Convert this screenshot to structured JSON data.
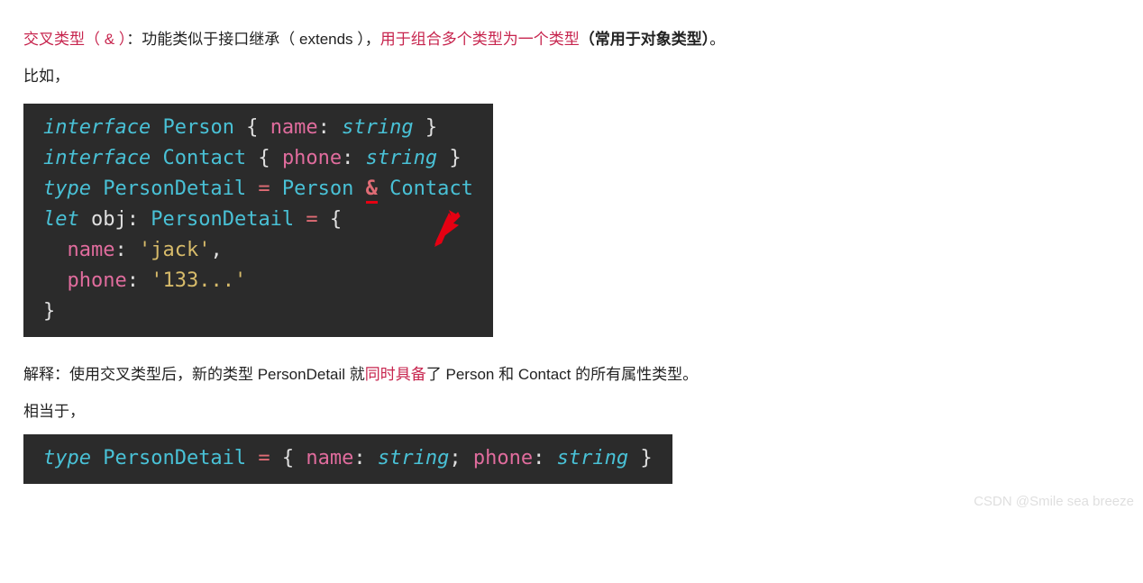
{
  "desc": {
    "intersection_label": "交叉类型",
    "paren_amp": "（ & ）",
    "func_text": "：功能类似于接口继承（ extends ），",
    "combine_text": "用于组合多个类型为一个类型",
    "object_type_text": "（常用于对象类型）",
    "period": "。"
  },
  "example_label": "比如，",
  "code1": {
    "l1_kw": "interface",
    "l1_type": " Person",
    "l1_brace_open": " { ",
    "l1_prop": "name",
    "l1_colon": ": ",
    "l1_strtype": "string",
    "l1_brace_close": " }",
    "l2_kw": "interface",
    "l2_type": " Contact",
    "l2_brace_open": " { ",
    "l2_prop": "phone",
    "l2_colon": ": ",
    "l2_strtype": "string",
    "l2_brace_close": " }",
    "l3_kw": "type",
    "l3_name": " PersonDetail ",
    "l3_eq": "=",
    "l3_person": " Person ",
    "l3_amp": "&",
    "l3_contact": " Contact",
    "l4_kw": "let",
    "l4_obj": " obj",
    "l4_colon": ": ",
    "l4_type": "PersonDetail ",
    "l4_eq": "=",
    "l4_brace": " {",
    "l5_indent": "  ",
    "l5_prop": "name",
    "l5_colon": ": ",
    "l5_val": "'jack'",
    "l5_comma": ",",
    "l6_indent": "  ",
    "l6_prop": "phone",
    "l6_colon": ": ",
    "l6_val": "'133...'",
    "l7_brace": "}"
  },
  "explain": {
    "prefix": "解释：使用交叉类型后，新的类型 PersonDetail 就",
    "highlight": "同时具备",
    "suffix": "了 Person 和 Contact 的所有属性类型。"
  },
  "equiv_label": "相当于，",
  "code2": {
    "kw": "type",
    "name": " PersonDetail ",
    "eq": "=",
    "brace_open": " { ",
    "p1": "name",
    "c1": ": ",
    "t1": "string",
    "semi": ";",
    "p2": " phone",
    "c2": ": ",
    "t2": "string",
    "brace_close": " }"
  },
  "watermark": "CSDN @Smile sea breeze"
}
